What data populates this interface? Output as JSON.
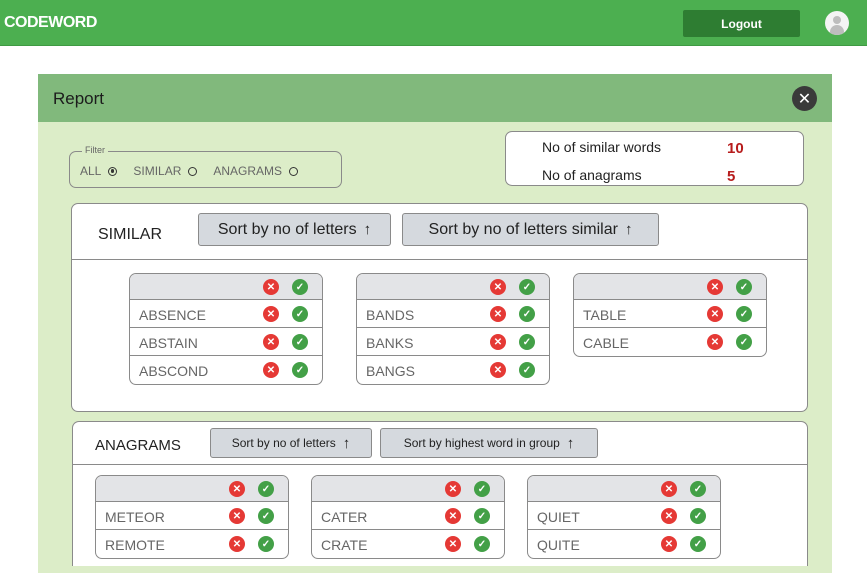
{
  "header": {
    "brand": "CODEWORD",
    "logout_label": "Logout"
  },
  "report": {
    "title": "Report",
    "close_icon": "✕"
  },
  "filter": {
    "legend": "Filter",
    "options": [
      {
        "label": "ALL",
        "checked": true
      },
      {
        "label": "SIMILAR",
        "checked": false
      },
      {
        "label": "ANAGRAMS",
        "checked": false
      }
    ]
  },
  "stats": [
    {
      "label": "No of similar words",
      "value": "10"
    },
    {
      "label": "No of anagrams",
      "value": "5"
    }
  ],
  "similar": {
    "title": "SIMILAR",
    "sort_buttons": [
      "Sort by no of letters",
      "Sort by no of letters similar"
    ],
    "groups": [
      [
        "ABSENCE",
        "ABSTAIN",
        "ABSCOND"
      ],
      [
        "BANDS",
        "BANKS",
        "BANGS"
      ],
      [
        "TABLE",
        "CABLE"
      ]
    ]
  },
  "anagrams": {
    "title": "ANAGRAMS",
    "sort_buttons": [
      "Sort by no of letters",
      "Sort by highest word in group"
    ],
    "groups": [
      [
        "METEOR",
        "REMOTE"
      ],
      [
        "CATER",
        "CRATE"
      ],
      [
        "QUIET",
        "QUITE"
      ]
    ]
  },
  "icons": {
    "reject": "✕",
    "accept": "✓",
    "sort": "↑"
  },
  "colors": {
    "header": "#4caf50",
    "panel_head": "#81b97c",
    "panel_bg": "#dcedc8",
    "reject": "#e53935",
    "accept": "#43a047",
    "stat_value": "#b71c1c"
  }
}
